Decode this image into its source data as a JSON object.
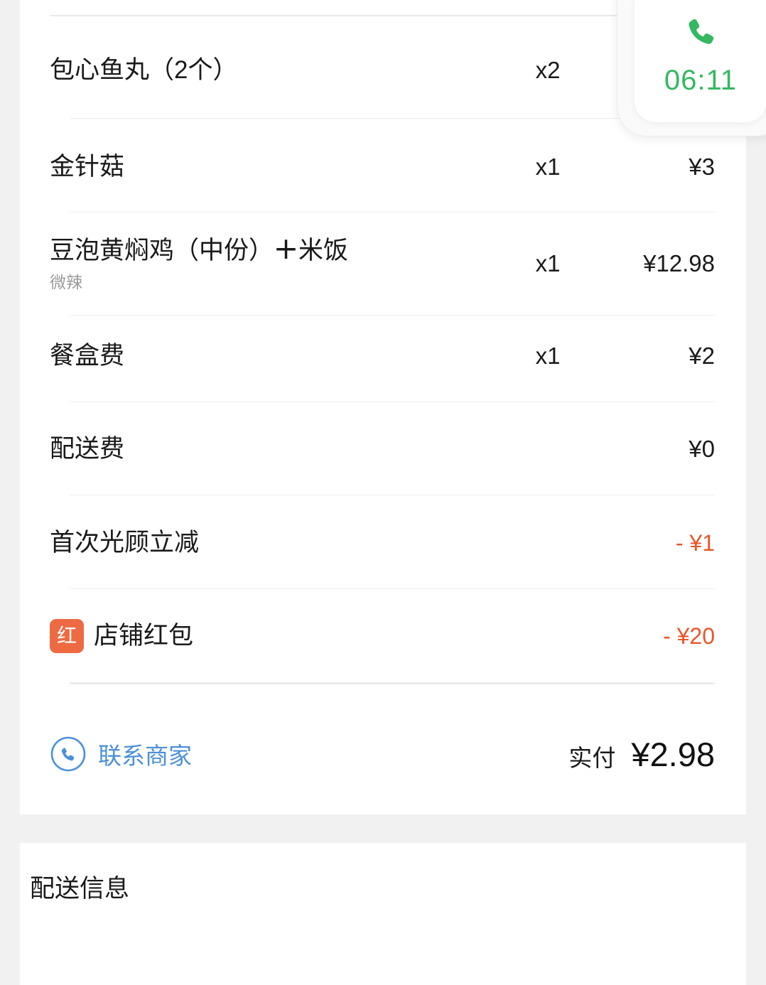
{
  "theme": {
    "page_bg": "#f1f1f1",
    "card_bg": "#ffffff",
    "text": "#1a1a1a",
    "muted": "#9a9a9a",
    "discount": "#e8572a",
    "link": "#4a90d9",
    "badge_bg": "#ed6a43",
    "call_green": "#34b861"
  },
  "order_items": [
    {
      "name": "包心鱼丸（2个）",
      "sub": "",
      "qty": "x2",
      "price": ""
    },
    {
      "name": "金针菇",
      "sub": "",
      "qty": "x1",
      "price": "¥3"
    },
    {
      "name": "豆泡黄焖鸡（中份）",
      "name_plus": "＋",
      "name_extra": "米饭",
      "sub": "微辣",
      "qty": "x1",
      "price": "¥12.98"
    },
    {
      "name": "餐盒费",
      "sub": "",
      "qty": "x1",
      "price": "¥2"
    },
    {
      "name": "配送费",
      "sub": "",
      "qty": "",
      "price": "¥0"
    }
  ],
  "discounts": [
    {
      "badge": "",
      "name": "首次光顾立减",
      "price": "- ¥1"
    },
    {
      "badge": "红",
      "name": "店铺红包",
      "price": "- ¥20"
    }
  ],
  "footer": {
    "contact_label": "联系商家",
    "contact_icon": "phone-circle-icon",
    "total_label": "实付",
    "total_amount": "¥2.98"
  },
  "delivery_section": {
    "title": "配送信息"
  },
  "call_widget": {
    "icon": "phone-icon",
    "timer": "06:11"
  }
}
